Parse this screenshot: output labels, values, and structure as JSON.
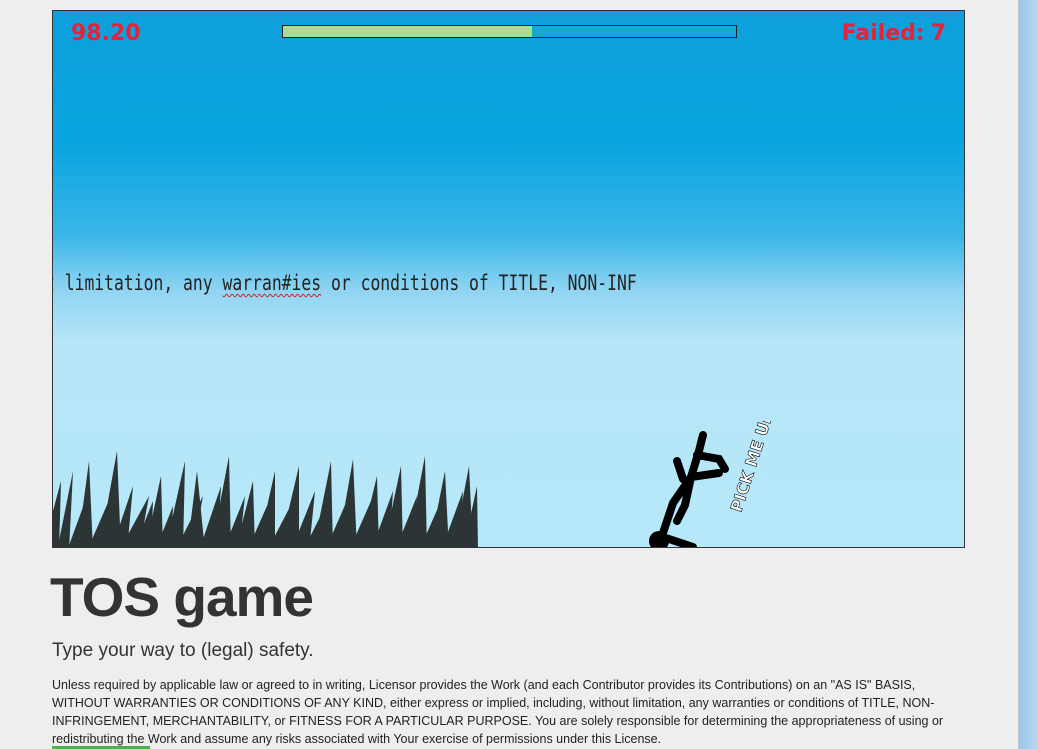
{
  "game": {
    "score": "98.20",
    "failed_label": "Failed:",
    "failed_count": "7",
    "progress": 0.55,
    "typing_text": {
      "before": "t limitation, any ",
      "typo": "warran#ies",
      "after": " or conditions of TITLE, NON-INF"
    },
    "character_sign": "PICK ME UP!!!!"
  },
  "page": {
    "title": "TOS game",
    "tagline": "Type your way to (legal) safety.",
    "license_text": "Unless required by applicable law or agreed to in writing, Licensor provides the Work (and each Contributor provides its Contributions) on an \"AS IS\" BASIS, WITHOUT WARRANTIES OR CONDITIONS OF ANY KIND, either express or implied, including, without limitation, any warranties or conditions of TITLE, NON-INFRINGEMENT, MERCHANTABILITY, or FITNESS FOR A PARTICULAR PURPOSE. You are solely responsible for determining the appropriateness of using or redistributing the Work and assume any risks associated with Your exercise of permissions under this License."
  },
  "colors": {
    "hud_red": "#e4233a",
    "progress_fill": "#a8dc98",
    "sky_top": "#0e9fdc",
    "sky_bottom": "#b6e8f9",
    "grass": "#2c3436"
  }
}
